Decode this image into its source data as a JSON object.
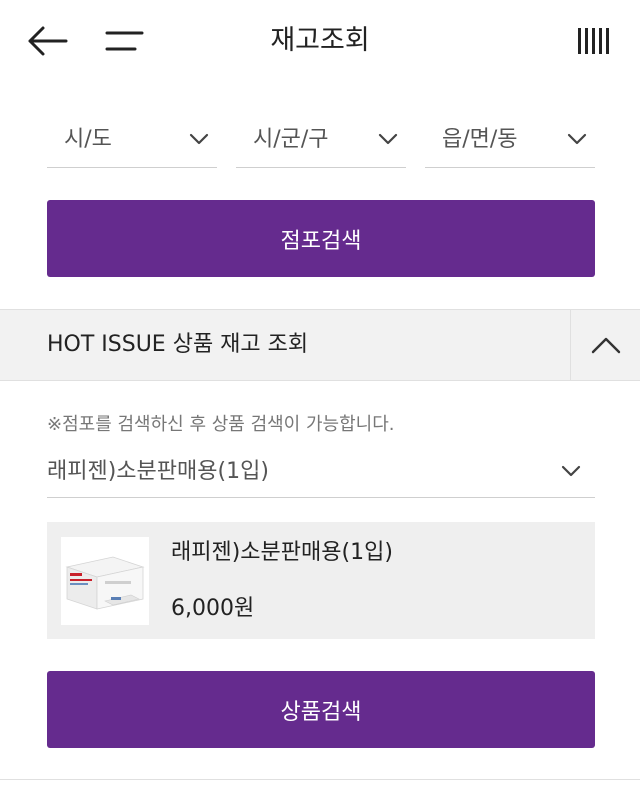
{
  "header": {
    "title": "재고조회"
  },
  "location": {
    "sido_label": "시/도",
    "sigungu_label": "시/군/구",
    "dong_label": "읍/면/동"
  },
  "store_search_label": "점포검색",
  "hot_issue": {
    "title": "HOT ISSUE 상품 재고 조회",
    "notice": "※점포를 검색하신 후 상품 검색이 가능합니다.",
    "selected_product": "래피젠)소분판매용(1입)",
    "product": {
      "name": "래피젠)소분판매용(1입)",
      "price": "6,000원"
    },
    "product_search_label": "상품검색"
  },
  "colors": {
    "primary": "#652b8e",
    "panel": "#f2f2f2"
  }
}
